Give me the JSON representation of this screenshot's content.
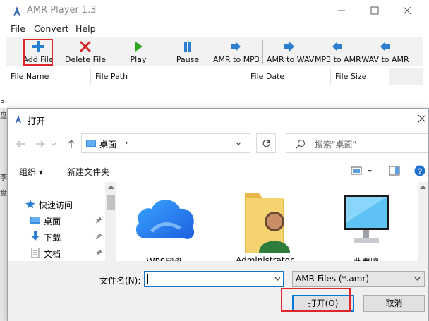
{
  "app": {
    "title": "AMR Player 1.3",
    "menu": [
      "File",
      "Convert",
      "Help"
    ],
    "toolbar": {
      "add_file": "Add File",
      "delete_file": "Delete File",
      "play": "Play",
      "pause": "Pause",
      "amr_to_mp3": "AMR to MP3",
      "amr_to_wav": "AMR to WAV",
      "mp3_to_amr": "MP3 to AMR",
      "wav_to_amr": "WAV to AMR"
    },
    "columns": [
      "File Name",
      "File Path",
      "File Date",
      "File Size"
    ]
  },
  "dialog": {
    "title": "打开",
    "address": "桌面",
    "address_sep": "›",
    "search_placeholder": "搜索\"桌面\"",
    "organize": "组织 ▾",
    "new_folder": "新建文件夹",
    "nav": {
      "quick_access": "快速访问",
      "items": [
        "桌面",
        "下载",
        "文档"
      ]
    },
    "files": [
      "WPS网盘",
      "Administrator",
      "此电脑"
    ],
    "filename_label": "文件名(N):",
    "filename_value": "",
    "filetype": "AMR Files (*.amr)",
    "open_button": "打开(O)",
    "cancel_button": "取消"
  },
  "edge_fragments": [
    "P",
    "盘",
    "李",
    "盘"
  ],
  "colors": {
    "highlight": "#e0262b",
    "accent": "#0078d7",
    "play_green": "#2fa41f",
    "arrow_blue": "#2b7fd1"
  }
}
